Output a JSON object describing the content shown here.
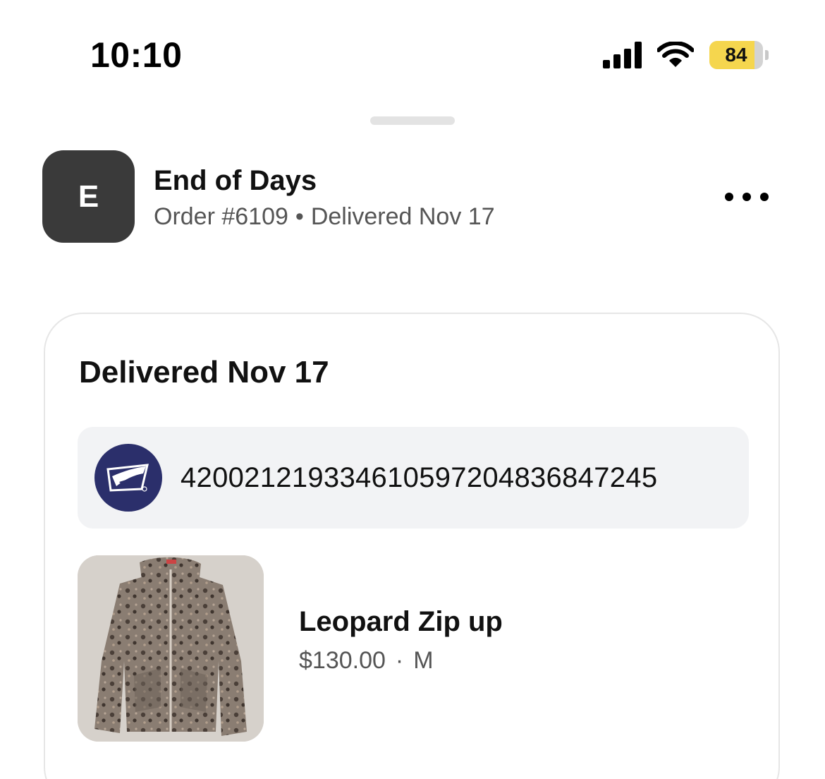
{
  "status_bar": {
    "time": "10:10",
    "battery_level": "84",
    "battery_percent": 84,
    "battery_color": "#f5d64e",
    "signal_icon": "cellular-signal-icon",
    "wifi_icon": "wifi-icon",
    "charging_icon": "charging-bolt-icon"
  },
  "header": {
    "avatar_letter": "E",
    "shop_name": "End of Days",
    "order_number": "Order #6109",
    "separator": "•",
    "delivery_status": "Delivered Nov 17",
    "more_icon": "more-horizontal-icon"
  },
  "shipment": {
    "title": "Delivered Nov 17",
    "carrier_icon": "usps-eagle-icon",
    "carrier_color": "#2b2f6b",
    "tracking_number": "420021219334610597204836847245"
  },
  "item": {
    "name": "Leopard Zip up",
    "price": "$130.00",
    "separator": "·",
    "size": "M",
    "image_icon": "leopard-zip-hoodie-image"
  }
}
